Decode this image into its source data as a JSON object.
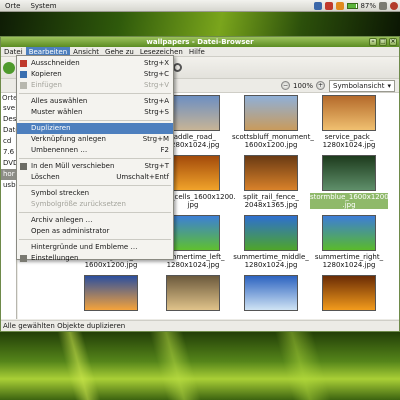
{
  "top_panel": {
    "menus": [
      "Orte",
      "System"
    ],
    "battery": "87%"
  },
  "window": {
    "title": "wallpapers - Datei-Browser",
    "menubar": [
      "Datei",
      "Bearbeiten",
      "Ansicht",
      "Gehe zu",
      "Lesezeichen",
      "Hilfe"
    ],
    "zoom": "100%",
    "view_mode": "Symbolansicht",
    "status": "Alle gewählten Objekte duplizieren"
  },
  "sidebar": {
    "title": "Orte",
    "items": [
      "sve",
      "Des",
      "Date",
      "cd",
      "7.6",
      "DVD",
      "hor",
      "usb"
    ]
  },
  "files": [
    {
      "name": "",
      "colors": [
        "#2d5fb5",
        "#9fc7f0"
      ]
    },
    {
      "name": "saddle_road_ 1280x1024.jpg",
      "colors": [
        "#6d8fc2",
        "#c7b496"
      ]
    },
    {
      "name": "scottsbluff_monument_ 1600x1200.jpg",
      "colors": [
        "#8fb0d8",
        "#c99b5c"
      ]
    },
    {
      "name": "service_pack_ 1280x1024.jpg",
      "colors": [
        "#b46a2b",
        "#f0c070"
      ]
    },
    {
      "name": "",
      "colors": [
        "#6a7fb8",
        "#d8dfe9"
      ]
    },
    {
      "name": "solar_cells_1600x1200. jpg",
      "colors": [
        "#a34b0b",
        "#f1a32a"
      ]
    },
    {
      "name": "split_rail_fence_ 2048x1365.jpg",
      "colors": [
        "#6a3a13",
        "#d9822a"
      ]
    },
    {
      "name": "stormblue_1600x1200 .jpg",
      "colors": [
        "#1d3b1d",
        "#5f8f6a"
      ]
    },
    {
      "name": "stormgreen_ 1600x1200.jpg",
      "colors": [
        "#243016",
        "#6e8a36"
      ]
    },
    {
      "name": "summertime_left_ 1280x1024.jpg",
      "colors": [
        "#3c7fd6",
        "#5fc02f"
      ]
    },
    {
      "name": "summertime_middle_ 1280x1024.jpg",
      "colors": [
        "#2e6fd0",
        "#4ea52a"
      ]
    },
    {
      "name": "summertime_right_ 1280x1024.jpg",
      "colors": [
        "#3d7dd8",
        "#5aba2b"
      ]
    },
    {
      "name": "",
      "colors": [
        "#2b4f9e",
        "#f5a33b"
      ]
    },
    {
      "name": "",
      "colors": [
        "#6c5a3d",
        "#e0c38a"
      ]
    },
    {
      "name": "",
      "colors": [
        "#2c63c0",
        "#cfe3f4"
      ]
    },
    {
      "name": "",
      "colors": [
        "#6a2c05",
        "#f29b1c"
      ]
    }
  ],
  "edit_menu": [
    {
      "label": "Ausschneiden",
      "accel": "Strg+X",
      "icon": "scissors-icon",
      "enabled": true
    },
    {
      "label": "Kopieren",
      "accel": "Strg+C",
      "icon": "copy-icon",
      "enabled": true
    },
    {
      "label": "Einfügen",
      "accel": "Strg+V",
      "icon": "paste-icon",
      "enabled": false
    },
    {
      "sep": true
    },
    {
      "label": "Alles auswählen",
      "accel": "Strg+A",
      "enabled": true
    },
    {
      "label": "Muster wählen",
      "accel": "Strg+S",
      "enabled": true
    },
    {
      "sep": true
    },
    {
      "label": "Duplizieren",
      "accel": "",
      "enabled": true,
      "highlight": true
    },
    {
      "label": "Verknüpfung anlegen",
      "accel": "Strg+M",
      "enabled": true
    },
    {
      "label": "Umbenennen …",
      "accel": "F2",
      "enabled": true
    },
    {
      "sep": true
    },
    {
      "label": "In den Müll verschieben",
      "accel": "Strg+T",
      "icon": "trash-icon",
      "enabled": true
    },
    {
      "label": "Löschen",
      "accel": "Umschalt+Entf",
      "enabled": true
    },
    {
      "sep": true
    },
    {
      "label": "Symbol strecken",
      "accel": "",
      "enabled": true
    },
    {
      "label": "Symbolgröße zurücksetzen",
      "accel": "",
      "enabled": false
    },
    {
      "sep": true
    },
    {
      "label": "Archiv anlegen …",
      "accel": "",
      "enabled": true
    },
    {
      "label": "Open as administrator",
      "accel": "",
      "enabled": true
    },
    {
      "sep": true
    },
    {
      "label": "Hintergründe und Embleme …",
      "accel": "",
      "enabled": true
    },
    {
      "label": "Einstellungen",
      "accel": "",
      "icon": "preferences-icon",
      "enabled": true
    }
  ]
}
